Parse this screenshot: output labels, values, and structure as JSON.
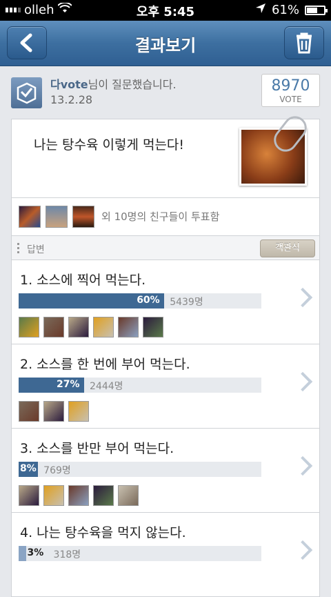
{
  "status": {
    "carrier": "olleh",
    "time": "오후 5:45",
    "battery": "61%",
    "battery_level": 0.61
  },
  "nav": {
    "title": "결과보기",
    "back_icon": "chevron-left-icon",
    "trash_icon": "trash-icon"
  },
  "asker": {
    "name": "다vote",
    "suffix": "님이 질문했습니다.",
    "date": "13.2.28"
  },
  "vote": {
    "count": "8970",
    "label": "VOTE"
  },
  "question": {
    "text": "나는 탕수육 이렇게 먹는다!"
  },
  "friends": {
    "text": "외 10명의 친구들이 투표함"
  },
  "answers": {
    "label": "답변",
    "objective_button": "객관식"
  },
  "options": [
    {
      "label": "1. 소스에 찍어 먹는다.",
      "pct": "60%",
      "count": "5439명",
      "value": 0.6,
      "avatars": 6
    },
    {
      "label": "2. 소스를 한 번에 부어 먹는다.",
      "pct": "27%",
      "count": "2444명",
      "value": 0.27,
      "avatars": 3
    },
    {
      "label": "3. 소스를 반만 부어 먹는다.",
      "pct": "8%",
      "count": "769명",
      "value": 0.08,
      "avatars": 5
    },
    {
      "label": "4. 나는 탕수육을 먹지 않는다.",
      "pct": "3%",
      "count": "318명",
      "value": 0.03,
      "avatars": 0
    }
  ],
  "colors": {
    "accent": "#3e6893",
    "nav": "#3d6fa0"
  }
}
